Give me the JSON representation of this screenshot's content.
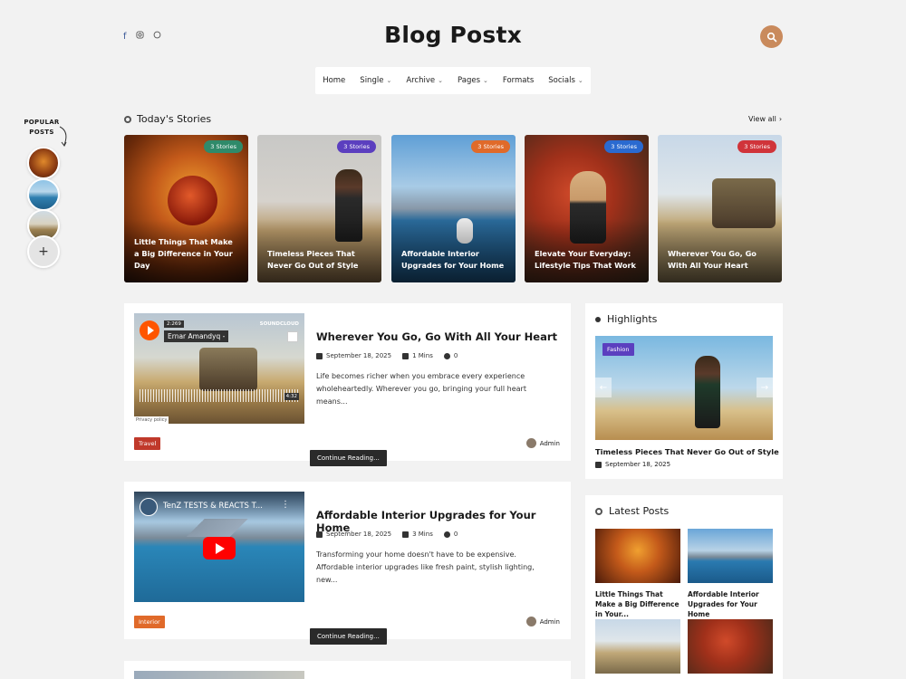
{
  "header": {
    "brand": "Blog Postx",
    "socials": [
      "f",
      "instagram",
      "whatsapp"
    ]
  },
  "nav": [
    {
      "label": "Home",
      "caret": false
    },
    {
      "label": "Single",
      "caret": true
    },
    {
      "label": "Archive",
      "caret": true
    },
    {
      "label": "Pages",
      "caret": true
    },
    {
      "label": "Formats",
      "caret": false
    },
    {
      "label": "Socials",
      "caret": true
    }
  ],
  "popular": {
    "label": "POPULAR POSTS",
    "add": "+"
  },
  "stories": {
    "title": "Today's Stories",
    "view_all": "View all",
    "items": [
      {
        "badge": "3 Stories",
        "badge_color": "#2f8a6a",
        "title": "Little Things That Make a Big Difference in Your Day"
      },
      {
        "badge": "3 Stories",
        "badge_color": "#5b3fbf",
        "title": "Timeless Pieces That Never Go Out of Style"
      },
      {
        "badge": "3 Stories",
        "badge_color": "#e06a2a",
        "title": "Affordable Interior Upgrades for Your Home"
      },
      {
        "badge": "3 Stories",
        "badge_color": "#2a6ad0",
        "title": "Elevate Your Everyday: Lifestyle Tips That Work"
      },
      {
        "badge": "3 Stories",
        "badge_color": "#d0343a",
        "title": "Wherever You Go, Go With All Your Heart"
      }
    ]
  },
  "posts": [
    {
      "title": "Wherever You Go, Go With All Your Heart",
      "date": "September 18, 2025",
      "read": "1 Mins",
      "comments": "0",
      "excerpt": "Life becomes richer when you embrace every experience wholeheartedly. Wherever you go, bringing your full heart means...",
      "category": "Travel",
      "category_color": "#c0392b",
      "author": "Admin",
      "cta": "Continue Reading...",
      "media": {
        "time": "2:269",
        "name": "Ernar Amandyq -",
        "logo": "SOUNDCLOUD",
        "duration": "4:32",
        "privacy": "Privacy policy"
      }
    },
    {
      "title": "Affordable Interior Upgrades for Your Home",
      "date": "September 18, 2025",
      "read": "3 Mins",
      "comments": "0",
      "excerpt": "Transforming your home doesn't have to be expensive. Affordable interior upgrades like fresh paint, stylish lighting, new...",
      "category": "Interior",
      "category_color": "#e06a2a",
      "author": "Admin",
      "cta": "Continue Reading...",
      "media": {
        "name": "TenZ TESTS & REACTS T..."
      }
    }
  ],
  "highlights": {
    "title": "Highlights",
    "badge": "Fashion",
    "post_title": "Timeless Pieces That Never Go Out of Style",
    "date": "September 18, 2025"
  },
  "latest": {
    "title": "Latest Posts",
    "items": [
      {
        "title": "Little Things That Make a Big Difference in Your..."
      },
      {
        "title": "Affordable Interior Upgrades for Your Home"
      },
      {
        "title": ""
      },
      {
        "title": ""
      }
    ]
  }
}
